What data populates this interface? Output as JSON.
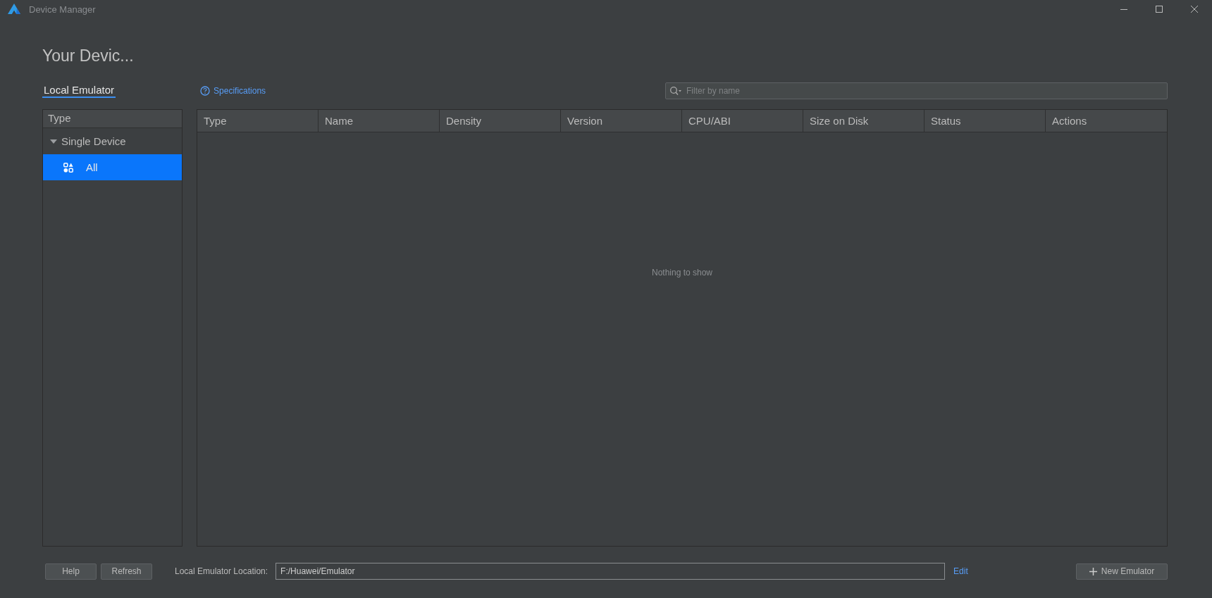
{
  "window": {
    "title": "Device Manager"
  },
  "heading": "Your Devic...",
  "tabs": [
    {
      "label": "Local Emulator",
      "selected": true
    }
  ],
  "specifications_link": "Specifications",
  "filter": {
    "placeholder": "Filter by name"
  },
  "sidebar": {
    "header": "Type",
    "items": [
      {
        "label": "Single Device",
        "expanded": true,
        "selected": false,
        "children": [
          {
            "label": "All",
            "selected": true
          }
        ]
      }
    ]
  },
  "table": {
    "columns": [
      "Type",
      "Name",
      "Density",
      "Version",
      "CPU/ABI",
      "Size on Disk",
      "Status",
      "Actions"
    ],
    "empty_text": "Nothing to show"
  },
  "footer": {
    "buttons": [
      "Help",
      "Refresh"
    ],
    "location_label": "Local Emulator Location:",
    "location_value": "F:/Huawei/Emulator",
    "edit_link": "Edit",
    "new_button": "New Emulator"
  }
}
